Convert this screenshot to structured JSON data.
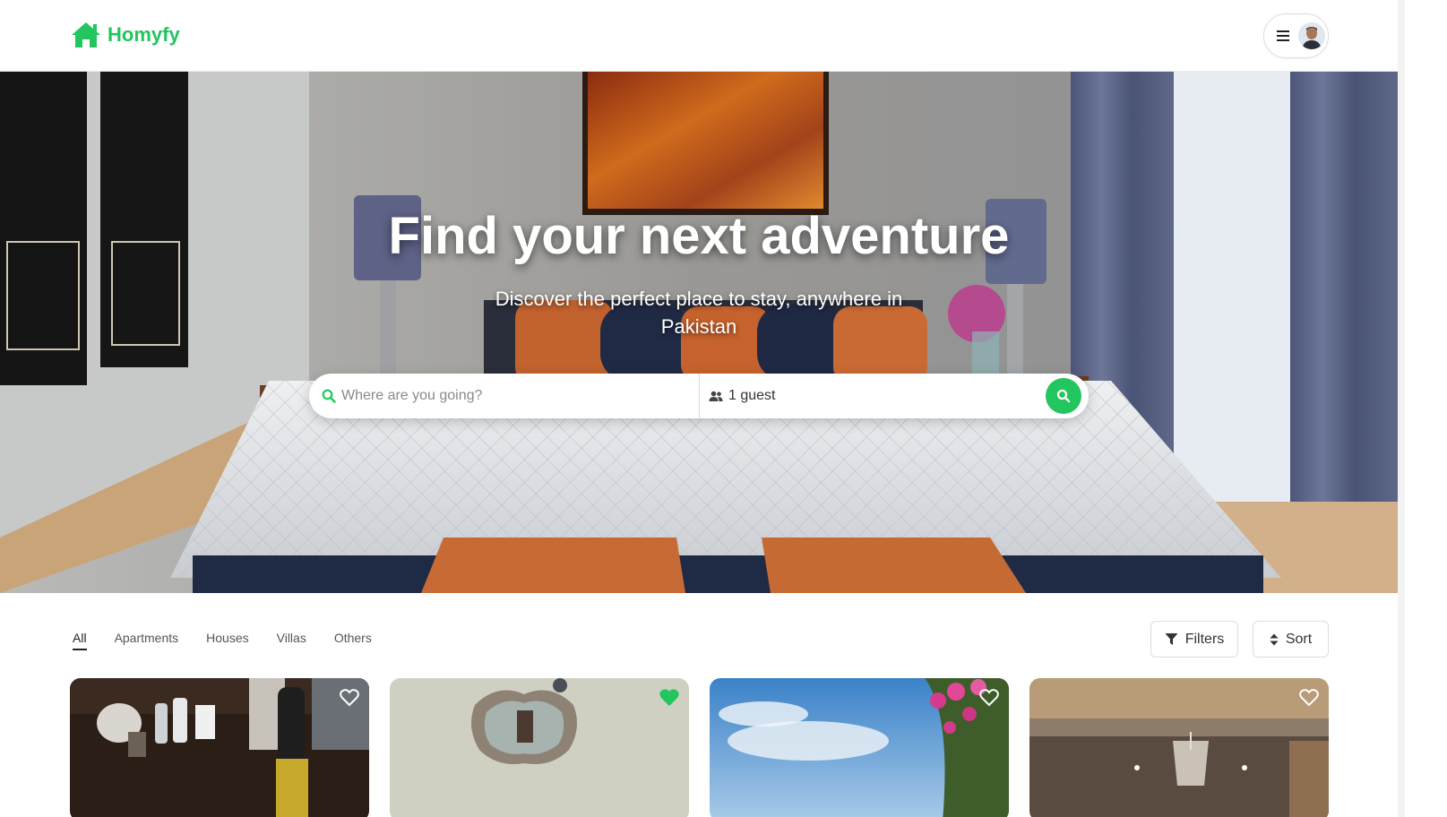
{
  "brand": {
    "name": "Homyfy",
    "color": "#22c55e",
    "icon": "house-icon"
  },
  "header": {
    "menu_icon": "hamburger-icon",
    "avatar": "user-avatar"
  },
  "hero": {
    "title": "Find your next adventure",
    "subtitle": "Discover the perfect place to stay, anywhere in Pakistan",
    "search": {
      "placeholder": "Where are you going?",
      "guests": "1 guest",
      "search_icon": "search-icon",
      "guests_icon": "users-icon"
    }
  },
  "categories": {
    "tabs": [
      "All",
      "Apartments",
      "Houses",
      "Villas",
      "Others"
    ],
    "active": "All"
  },
  "controls": {
    "filters_label": "Filters",
    "sort_label": "Sort"
  },
  "listings": [
    {
      "image": "nightstand-photo",
      "favorited": false
    },
    {
      "image": "mirror-wall-photo",
      "favorited": true
    },
    {
      "image": "sky-bougainvillea-photo",
      "favorited": false
    },
    {
      "image": "ceiling-chandelier-photo",
      "favorited": false
    }
  ]
}
